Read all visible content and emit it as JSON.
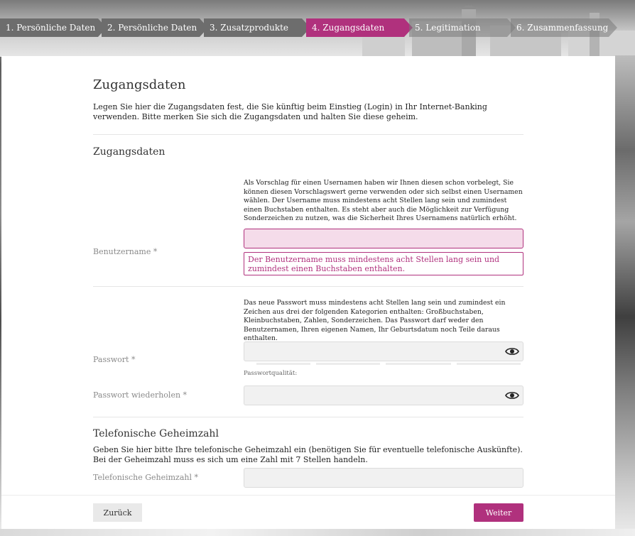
{
  "steps": [
    {
      "label": "1. Persönliche Daten",
      "state": "done"
    },
    {
      "label": "2. Persönliche Daten",
      "state": "done"
    },
    {
      "label": "3. Zusatzprodukte",
      "state": "done"
    },
    {
      "label": "4. Zugangsdaten",
      "state": "active"
    },
    {
      "label": "5. Legitimation",
      "state": "future"
    },
    {
      "label": "6. Zusammenfassung",
      "state": "future"
    }
  ],
  "page": {
    "title": "Zugangsdaten",
    "intro": "Legen Sie hier die Zugangsdaten fest, die Sie künftig beim Einstieg (Login) in Ihr Internet-Banking verwenden. Bitte merken Sie sich die Zugangsdaten und halten Sie diese geheim."
  },
  "access_section": {
    "title": "Zugangsdaten",
    "username_hint": "Als Vorschlag für einen Usernamen haben wir Ihnen diesen schon vorbelegt, Sie können diesen Vorschlagswert gerne verwenden oder sich selbst einen Usernamen wählen. Der Username muss mindestens acht Stellen lang sein und zumindest einen Buchstaben enthalten. Es steht aber auch die Möglichkeit zur Verfügung Sonderzeichen zu nutzen, was die Sicherheit Ihres Usernamens natürlich erhöht.",
    "username_label": "Benutzername *",
    "username_value": "",
    "username_error": "Der Benutzername muss mindestens acht Stellen lang sein und zumindest einen Buchstaben enthalten.",
    "password_hint": "Das neue Passwort muss mindestens acht Stellen lang sein und zumindest ein Zeichen aus drei der folgenden Kategorien enthalten: Großbuchstaben, Kleinbuchstaben, Zahlen, Sonderzeichen. Das Passwort darf weder den Benutzernamen, Ihren eigenen Namen, Ihr Geburtsdatum noch Teile daraus enthalten.",
    "password_label": "Passwort *",
    "password_value": "",
    "password_quality_label": "Passwortqualität:",
    "password_repeat_label": "Passwort wiederholen *",
    "password_repeat_value": ""
  },
  "phone_section": {
    "title": "Telefonische Geheimzahl",
    "description": "Geben Sie hier bitte Ihre telefonische Geheimzahl ein (benötigen Sie für eventuelle telefonische Auskünfte). Bei der Geheimzahl muss es sich um eine Zahl mit 7 Stellen handeln.",
    "pin_label": "Telefonische Geheimzahl *",
    "pin_value": ""
  },
  "footer": {
    "back_label": "Zurück",
    "next_label": "Weiter"
  },
  "colors": {
    "accent": "#b0317d",
    "step_done": "#6d6d6d",
    "field_bg": "#f1f1f1",
    "error_bg": "#f5dcea"
  }
}
